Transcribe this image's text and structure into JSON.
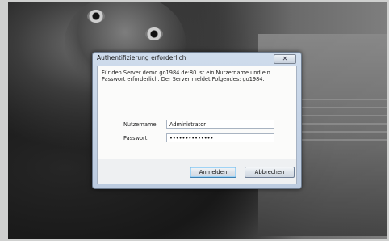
{
  "dialog": {
    "title": "Authentifizierung erforderlich",
    "close_label": "✕",
    "message": "Für den Server demo.go1984.de:80 ist ein Nutzername und ein Passwort erforderlich. Der Server meldet Folgendes: go1984.",
    "username_label": "Nutzername:",
    "username_value": "Administrator",
    "password_label": "Passwort:",
    "password_value": "••••••••••••••",
    "ok_label": "Anmelden",
    "cancel_label": "Abbrechen"
  }
}
